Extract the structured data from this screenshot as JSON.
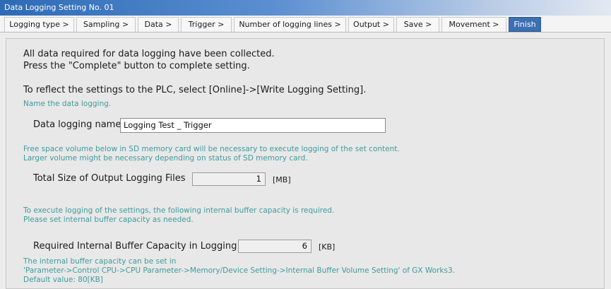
{
  "window": {
    "title": "Data Logging Setting No. 01"
  },
  "tabs": [
    {
      "label": "Logging type >"
    },
    {
      "label": "Sampling >"
    },
    {
      "label": "Data >"
    },
    {
      "label": "Trigger >"
    },
    {
      "label": "Number of logging lines >"
    },
    {
      "label": "Output >"
    },
    {
      "label": "Save >"
    },
    {
      "label": "Movement >"
    },
    {
      "label": "Finish",
      "active": true
    }
  ],
  "content": {
    "line1": "All data required for data logging have been collected.",
    "line2": "Press the \"Complete\" button to complete setting.",
    "line3": "To reflect the settings to the PLC, select [Online]->[Write Logging Setting].",
    "name_hint": "Name the data logging.",
    "name_label": "Data logging name",
    "name_value": "Logging Test _ Trigger",
    "sd_hint_1": "Free space volume below in SD memory card will be necessary to execute logging of the set content.",
    "sd_hint_2": "Larger volume might be necessary depending on status of SD memory card.",
    "total_size_label": "Total Size of Output Logging Files",
    "total_size_value": "1",
    "total_size_unit": "[MB]",
    "buffer_hint_1": "To execute logging of the settings, the following internal buffer capacity is required.",
    "buffer_hint_2": "Please set internal buffer capacity as needed.",
    "buffer_label": "Required Internal Buffer Capacity in Logging",
    "buffer_value": "6",
    "buffer_unit": "[KB]",
    "footer_1": "The internal buffer capacity can be set in",
    "footer_2": "'Parameter->Control CPU->CPU Parameter->Memory/Device Setting->Internal Buffer Volume Setting' of GX Works3.",
    "footer_3": "Default value: 80[KB]"
  },
  "colors": {
    "accent": "#3c6fb3",
    "hint_text": "#3f9b9b"
  }
}
